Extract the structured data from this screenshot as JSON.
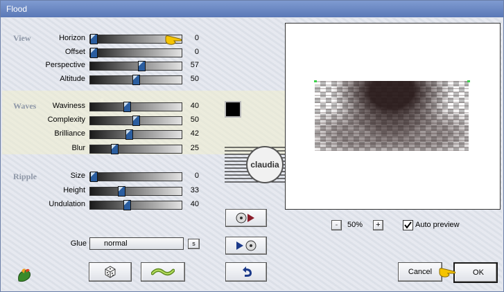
{
  "window": {
    "title": "Flood"
  },
  "sections": {
    "view": "View",
    "waves": "Waves",
    "ripple": "Ripple"
  },
  "params": [
    {
      "label": "Horizon",
      "value": "0",
      "level": 0
    },
    {
      "label": "Offset",
      "value": "0",
      "level": 0
    },
    {
      "label": "Perspective",
      "value": "57",
      "level": 57
    },
    {
      "label": "Altitude",
      "value": "50",
      "level": 50
    },
    {
      "label": "Waviness",
      "value": "40",
      "level": 40
    },
    {
      "label": "Complexity",
      "value": "50",
      "level": 50
    },
    {
      "label": "Brilliance",
      "value": "42",
      "level": 42
    },
    {
      "label": "Blur",
      "value": "25",
      "level": 25
    },
    {
      "label": "Size",
      "value": "0",
      "level": 0
    },
    {
      "label": "Height",
      "value": "33",
      "level": 33
    },
    {
      "label": "Undulation",
      "value": "40",
      "level": 40
    }
  ],
  "glue": {
    "label": "Glue",
    "value": "normal",
    "btn": "s"
  },
  "zoom": {
    "minus": "-",
    "value": "50%",
    "plus": "+"
  },
  "auto_preview": {
    "label": "Auto preview",
    "checked": true
  },
  "buttons": {
    "cancel": "Cancel",
    "ok": "OK"
  },
  "watermark": {
    "text": "claudia"
  },
  "colors": {
    "swatch": "#000000",
    "title_bar": "#6a88c4"
  }
}
